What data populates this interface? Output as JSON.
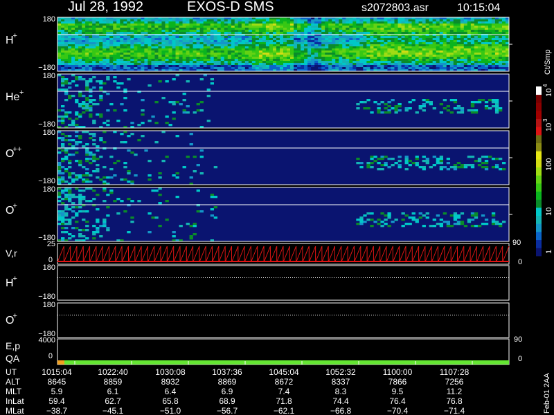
{
  "header": {
    "date": "Jul 28, 1992",
    "instrument": "EXOS-D SMS",
    "file": "s2072803.asr",
    "time": "10:15:04"
  },
  "colorbar": {
    "label": "Ct/Smp",
    "ticks": [
      "1",
      "10",
      "100",
      "10",
      "10"
    ],
    "tick_exponents": [
      "",
      "",
      "",
      "3",
      "4"
    ],
    "colors": [
      "#0a1470",
      "#0a2da0",
      "#0a64c8",
      "#1496c8",
      "#14b4b4",
      "#00c8c8",
      "#0a8c2a",
      "#0ab41e",
      "#37c814",
      "#64d214",
      "#a0dc14",
      "#d2dc14",
      "#e6e614",
      "#8c8c14",
      "#6e6e14",
      "#dc1414",
      "#b41414",
      "#a00000",
      "#8c0000",
      "#780000",
      "#ffffff"
    ]
  },
  "panels": [
    {
      "name": "H+",
      "label": "H",
      "sup": "+",
      "ymax": "180",
      "ymin": "−180",
      "kind": "spec_h"
    },
    {
      "name": "He+",
      "label": "He",
      "sup": "+",
      "ymax": "180",
      "ymin": "−180",
      "kind": "spec_he"
    },
    {
      "name": "O++",
      "label": "O",
      "sup": "++",
      "ymax": "180",
      "ymin": "−180",
      "kind": "spec_o2"
    },
    {
      "name": "O+",
      "label": "O",
      "sup": "+",
      "ymax": "180",
      "ymin": "−180",
      "kind": "spec_o"
    }
  ],
  "vr_panel": {
    "label": "V,r",
    "ymax": "25",
    "ymin": "0",
    "right_max": "90",
    "right_min": "0"
  },
  "line_panels": [
    {
      "name": "H+",
      "label": "H",
      "sup": "+",
      "ymax": "180",
      "ymin": "−180"
    },
    {
      "name": "O+",
      "label": "O",
      "sup": "+",
      "ymax": "180",
      "ymin": "−180"
    }
  ],
  "ep_panel": {
    "label": "E,p",
    "ymax": "4000",
    "right_tick": "90"
  },
  "qa_panel": {
    "label": "QA",
    "ymin": "0",
    "right_tick": "0"
  },
  "footer_table": {
    "row_labels": [
      "UT",
      "ALT",
      "MLT",
      "InLat",
      "MLat"
    ],
    "columns": [
      [
        "1015:04",
        "8645",
        "5.9",
        "59.4",
        "−38.7"
      ],
      [
        "1022:40",
        "8859",
        "6.1",
        "62.7",
        "−45.1"
      ],
      [
        "1030:08",
        "8932",
        "6.4",
        "65.8",
        "−51.0"
      ],
      [
        "1037:36",
        "8869",
        "6.9",
        "68.9",
        "−56.7"
      ],
      [
        "1045:04",
        "8672",
        "7.4",
        "71.8",
        "−62.1"
      ],
      [
        "1052:32",
        "8337",
        "8.3",
        "74.4",
        "−66.8"
      ],
      [
        "1100:00",
        "7866",
        "9.5",
        "76.4",
        "−70.4"
      ],
      [
        "1107:28",
        "7256",
        "11.2",
        "76.8",
        "−71.4"
      ]
    ]
  },
  "side_note": "Feb-01 2AA",
  "chart_data": {
    "type": "heatmap",
    "title": "Jul 28, 1992   EXOS-D SMS",
    "x_ticks_ut": [
      "1015:04",
      "1022:40",
      "1030:08",
      "1037:36",
      "1045:04",
      "1052:32",
      "1100:00",
      "1107:28"
    ],
    "series": [
      {
        "name": "H+",
        "ylim": [
          -180,
          180
        ],
        "units": "Ct/Smp",
        "scale": "log",
        "crange": [
          1,
          10000
        ]
      },
      {
        "name": "He+",
        "ylim": [
          -180,
          180
        ],
        "units": "Ct/Smp",
        "scale": "log",
        "crange": [
          1,
          10000
        ]
      },
      {
        "name": "O++",
        "ylim": [
          -180,
          180
        ],
        "units": "Ct/Smp",
        "scale": "log",
        "crange": [
          1,
          10000
        ]
      },
      {
        "name": "O+",
        "ylim": [
          -180,
          180
        ],
        "units": "Ct/Smp",
        "scale": "log",
        "crange": [
          1,
          10000
        ]
      }
    ],
    "line_series": [
      {
        "name": "V,r",
        "ylim": [
          0,
          25
        ],
        "right_ylim": [
          0,
          90
        ],
        "color": "#e01414"
      },
      {
        "name": "H+",
        "ylim": [
          -180,
          180
        ]
      },
      {
        "name": "O+",
        "ylim": [
          -180,
          180
        ]
      },
      {
        "name": "E,p",
        "ylim": [
          0,
          4000
        ],
        "right_tick": 90
      },
      {
        "name": "QA",
        "ylim": [
          0,
          0
        ],
        "color": "#64e632"
      }
    ]
  }
}
